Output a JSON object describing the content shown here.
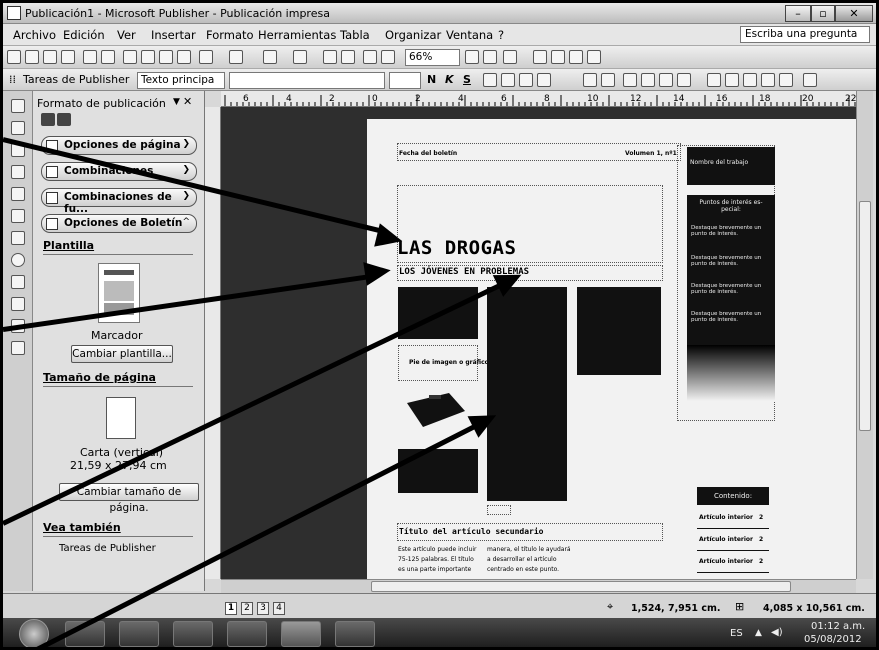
{
  "window": {
    "title": "Publicación1 - Microsoft Publisher - Publicación impresa"
  },
  "menu": {
    "items": [
      "Archivo",
      "Edición",
      "Ver",
      "Insertar",
      "Formato",
      "Herramientas",
      "Tabla",
      "Organizar",
      "Ventana",
      "?"
    ],
    "ask": "Escriba una pregunta"
  },
  "toolbar": {
    "zoom": "66%",
    "tasks_label": "Tareas de Publisher",
    "style_value": "Texto principa",
    "bold": "N",
    "italic": "K",
    "underline": "S"
  },
  "taskpane": {
    "title": "Formato de publicación",
    "sections": [
      "Opciones de página",
      "Combinaciones",
      "Combinaciones de fu...",
      "Opciones de Boletín"
    ],
    "template_label": "Plantilla",
    "template_name": "Marcador",
    "change_template": "Cambiar plantilla...",
    "page_size_label": "Tamaño de página",
    "page_size_name": "Carta (vertical)",
    "page_size_dims": "21,59 x 27,94 cm",
    "change_page_size": "Cambiar tamaño de página.",
    "see_also_label": "Vea también",
    "see_also_item": "Tareas de Publisher"
  },
  "document": {
    "bulletin_date": "Fecha del boletín",
    "volume": "Volumen 1, nº1",
    "work_name": "Nombre del trabajo",
    "interest_title": "Puntos de interés es-pecial:",
    "interest_items": [
      "Destaque brevemente un punto de interés.",
      "Destaque brevemente un punto de interés.",
      "Destaque brevemente un punto de interés.",
      "Destaque brevemente un punto de interés."
    ],
    "headline": "LAS DROGAS",
    "subhead": "LOS JÓVENES EN PROBLEMAS",
    "caption": "Pie de imagen o gráfico.",
    "secondary_title": "Título del artículo secundario",
    "secondary_col1": "Este artículo puede incluir 75-125 palabras. El título es una parte importante",
    "secondary_col2": "manera, el título le ayudará a desarrollar el artículo centrado en este punto.",
    "contents_title": "Contenido:",
    "contents_rows": [
      {
        "label": "Artículo interior",
        "page": "2"
      },
      {
        "label": "Artículo interior",
        "page": "2"
      },
      {
        "label": "Artículo interior",
        "page": "2"
      }
    ],
    "ruler_numbers": [
      "6",
      "4",
      "2",
      "0",
      "2",
      "4",
      "6",
      "8",
      "10",
      "12",
      "14",
      "16",
      "18",
      "20",
      "22"
    ]
  },
  "status": {
    "pages": [
      "1",
      "2",
      "3",
      "4"
    ],
    "position": "1,524, 7,951 cm.",
    "size": "4,085 x 10,561 cm."
  },
  "taskbar": {
    "lang": "ES",
    "time": "01:12 a.m.",
    "date": "05/08/2012"
  }
}
